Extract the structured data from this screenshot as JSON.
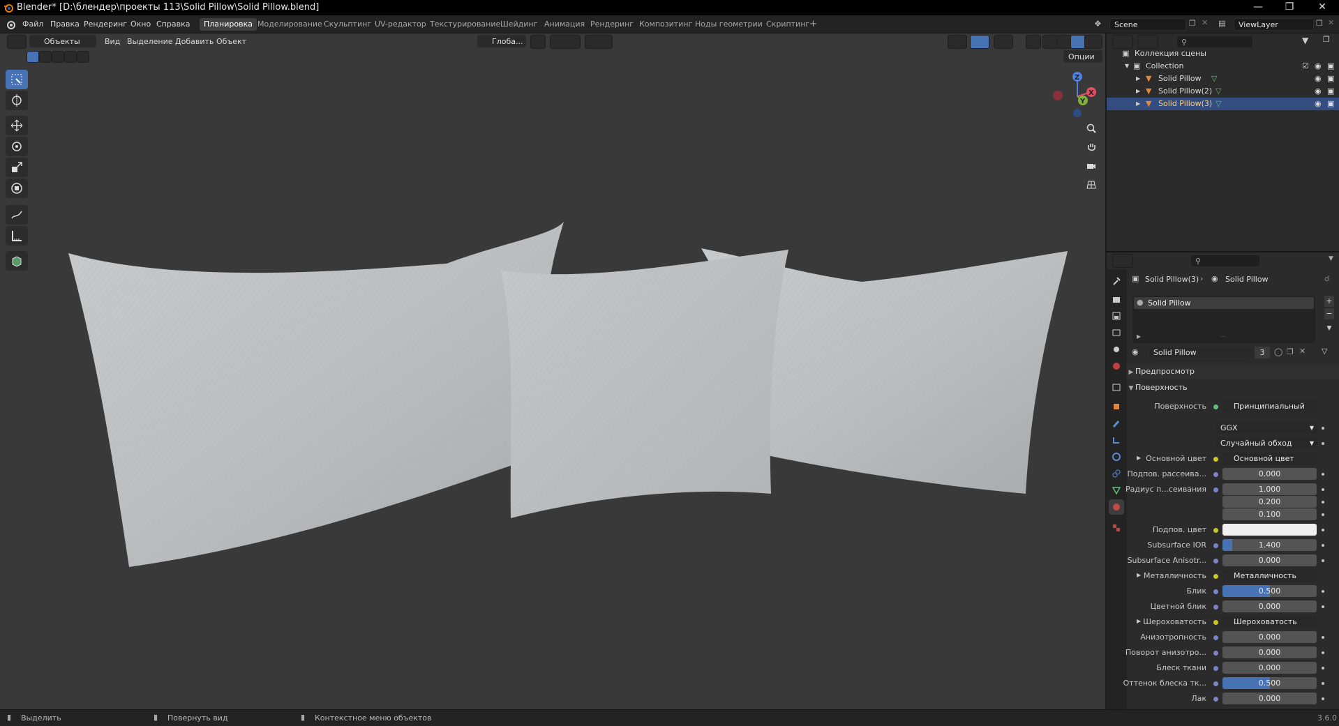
{
  "title_bar": {
    "title": "Blender* [D:\\блендер\\проекты 113\\Solid Pillow\\Solid Pillow.blend]"
  },
  "menus": [
    "Файл",
    "Правка",
    "Рендеринг",
    "Окно",
    "Справка"
  ],
  "workspaces": [
    "Планировка",
    "Моделирование",
    "Скульптинг",
    "UV-редактор",
    "Текстурирование",
    "Шейдинг",
    "Анимация",
    "Рендеринг",
    "Композитинг",
    "Ноды геометрии",
    "Скриптинг"
  ],
  "active_workspace": "Планировка",
  "scene": {
    "name": "Scene",
    "view_layer": "ViewLayer"
  },
  "viewport_header": {
    "mode": "Объекты",
    "menus": [
      "Вид",
      "Выделение",
      "Добавить",
      "Объект"
    ],
    "transform_orientation": "Глоба...",
    "options": "Опции"
  },
  "gizmo": {
    "x": "X",
    "y": "Y",
    "z": "Z"
  },
  "outliner": {
    "root": "Коллекция сцены",
    "collection": "Collection",
    "items": [
      "Solid Pillow",
      "Solid Pillow(2)",
      "Solid Pillow(3)"
    ],
    "selected_index": 2
  },
  "properties": {
    "breadcrumb": {
      "object": "Solid Pillow(3)",
      "material": "Solid Pillow"
    },
    "slot": "Solid Pillow",
    "material_name": "Solid Pillow",
    "users": "3",
    "sections": {
      "preview": "Предпросмотр",
      "surface": "Поверхность"
    },
    "surface_label": "Поверхность",
    "surface_value": "Принципиальный BSDF",
    "distribution": "GGX",
    "subsurface_method": "Случайный обход",
    "rows": [
      {
        "label": "Основной цвет",
        "value": "Основной цвет",
        "kind": "link",
        "expand": true
      },
      {
        "label": "Подпов. рассеива...",
        "value": "0.000",
        "kind": "num"
      },
      {
        "label": "Радиус п...сеивания",
        "value": "1.000",
        "kind": "num"
      },
      {
        "label": "",
        "value": "0.200",
        "kind": "num"
      },
      {
        "label": "",
        "value": "0.100",
        "kind": "num"
      },
      {
        "label": "Подпов. цвет",
        "value": "",
        "kind": "color"
      },
      {
        "label": "Subsurface IOR",
        "value": "1.400",
        "kind": "num",
        "fill": 0.1
      },
      {
        "label": "Subsurface Anisotr...",
        "value": "0.000",
        "kind": "num"
      },
      {
        "label": "Металличность",
        "value": "Металличность",
        "kind": "link",
        "expand": true
      },
      {
        "label": "Блик",
        "value": "0.500",
        "kind": "num",
        "fill": 0.5
      },
      {
        "label": "Цветной блик",
        "value": "0.000",
        "kind": "num"
      },
      {
        "label": "Шероховатость",
        "value": "Шероховатость",
        "kind": "link",
        "expand": true
      },
      {
        "label": "Анизотропность",
        "value": "0.000",
        "kind": "num"
      },
      {
        "label": "Поворот анизотро...",
        "value": "0.000",
        "kind": "num"
      },
      {
        "label": "Блеск ткани",
        "value": "0.000",
        "kind": "num"
      },
      {
        "label": "Оттенок блеска тк...",
        "value": "0.500",
        "kind": "num",
        "fill": 0.5
      },
      {
        "label": "Лак",
        "value": "0.000",
        "kind": "num"
      }
    ]
  },
  "status_bar": {
    "select": "Выделить",
    "rotate": "Повернуть вид",
    "context": "Контекстное меню объектов",
    "version": "3.6.0"
  },
  "colors": {
    "accent": "#4772b3",
    "selection": "#334d80",
    "viewport": "#393939",
    "pillow": "#bfc0c2"
  }
}
